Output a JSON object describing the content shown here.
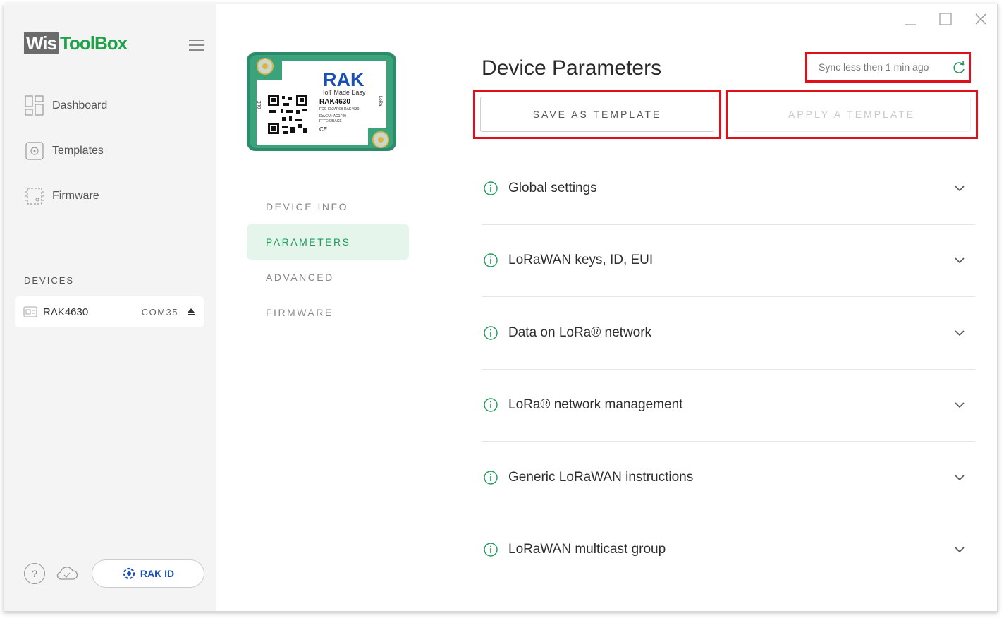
{
  "app": {
    "logo_part1": "Wis",
    "logo_part2": "ToolBox"
  },
  "sidebar": {
    "nav": [
      {
        "label": "Dashboard",
        "icon": "dashboard-icon"
      },
      {
        "label": "Templates",
        "icon": "templates-icon"
      },
      {
        "label": "Firmware",
        "icon": "firmware-chip-icon"
      }
    ],
    "devices_title": "DEVICES",
    "device": {
      "name": "RAK4630",
      "port": "COM35",
      "icon": "device-module-icon"
    },
    "rak_id_label": "RAK ID",
    "help_label": "?"
  },
  "device_panel": {
    "module": {
      "brand": "RAK",
      "tagline": "IoT Made Easy",
      "model": "RAK4630",
      "fcc": "FCC ID:2AF6B-RAK4630",
      "deveui_line1": "DevEUI: AC1F09",
      "deveui_line2": "FFFE03BACE",
      "side_left": "BLE",
      "side_right": "LoRa",
      "ce_mark": "CE"
    },
    "tabs": [
      {
        "label": "DEVICE INFO",
        "active": false
      },
      {
        "label": "PARAMETERS",
        "active": true
      },
      {
        "label": "ADVANCED",
        "active": false
      },
      {
        "label": "FIRMWARE",
        "active": false
      }
    ]
  },
  "main": {
    "title": "Device Parameters",
    "sync_text": "Sync less then 1 min ago",
    "save_template_label": "SAVE AS TEMPLATE",
    "apply_template_label": "APPLY A TEMPLATE",
    "sections": [
      "Global settings",
      "LoRaWAN keys, ID, EUI",
      "Data on LoRa® network",
      "LoRa® network management",
      "Generic LoRaWAN instructions",
      "LoRaWAN multicast group"
    ]
  },
  "colors": {
    "accent_green": "#1f9a58",
    "highlight_red": "#e0101a",
    "rak_blue": "#1a4fb3"
  }
}
